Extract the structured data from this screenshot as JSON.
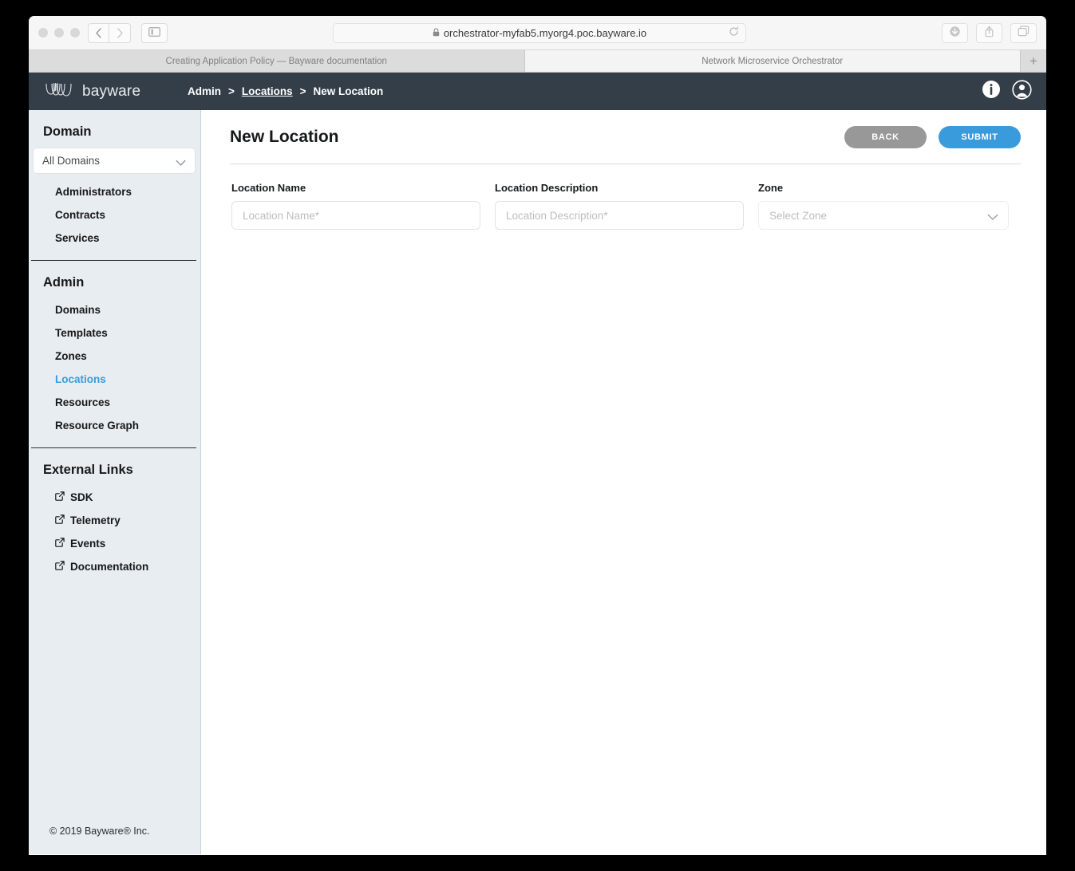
{
  "browser": {
    "url": "orchestrator-myfab5.myorg4.poc.bayware.io",
    "back_icon": "chevron-left-icon",
    "forward_icon": "chevron-right-icon",
    "sidebar_icon": "sidebar-toggle-icon",
    "lock_icon": "lock-icon",
    "reload_icon": "reload-icon",
    "download_icon": "download-icon",
    "share_icon": "share-icon",
    "tabs_icon": "tab-overview-icon",
    "new_tab_label": "+",
    "tabs": [
      {
        "label": "Creating Application Policy — Bayware documentation",
        "active": false
      },
      {
        "label": "Network Microservice Orchestrator",
        "active": true
      }
    ]
  },
  "header": {
    "logo_text": "bayware",
    "breadcrumb": [
      {
        "label": "Admin",
        "link": false
      },
      {
        "label": "Locations",
        "link": true
      },
      {
        "label": "New Location",
        "link": false
      }
    ],
    "separator": ">",
    "info_icon": "info-icon",
    "account_icon": "user-account-icon"
  },
  "sidebar": {
    "domain": {
      "title": "Domain",
      "select_value": "All Domains",
      "items": [
        {
          "label": "Administrators",
          "active": false
        },
        {
          "label": "Contracts",
          "active": false
        },
        {
          "label": "Services",
          "active": false
        }
      ]
    },
    "admin": {
      "title": "Admin",
      "items": [
        {
          "label": "Domains",
          "active": false
        },
        {
          "label": "Templates",
          "active": false
        },
        {
          "label": "Zones",
          "active": false
        },
        {
          "label": "Locations",
          "active": true
        },
        {
          "label": "Resources",
          "active": false
        },
        {
          "label": "Resource Graph",
          "active": false
        }
      ]
    },
    "external": {
      "title": "External Links",
      "items": [
        {
          "label": "SDK"
        },
        {
          "label": "Telemetry"
        },
        {
          "label": "Events"
        },
        {
          "label": "Documentation"
        }
      ]
    },
    "footer": "© 2019 Bayware® Inc."
  },
  "main": {
    "title": "New Location",
    "back_label": "BACK",
    "submit_label": "SUBMIT",
    "fields": {
      "name": {
        "label": "Location Name",
        "value": "",
        "placeholder": "Location Name*"
      },
      "description": {
        "label": "Location Description",
        "value": "",
        "placeholder": "Location Description*"
      },
      "zone": {
        "label": "Zone",
        "value": "Select Zone",
        "chevron_icon": "chevron-down-icon"
      }
    }
  },
  "colors": {
    "accent_blue": "#3a9bdc",
    "header_dark": "#333e48",
    "sidebar_bg": "#e8edf1",
    "back_gray": "#989898"
  }
}
